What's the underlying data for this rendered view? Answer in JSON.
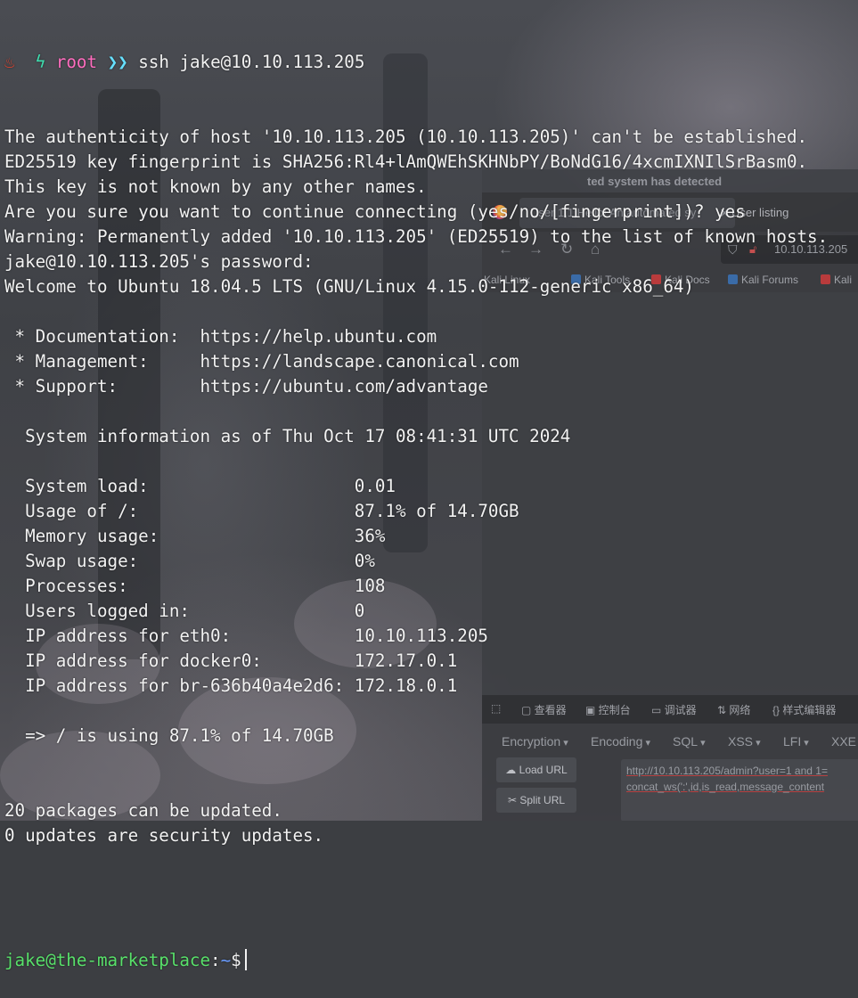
{
  "terminal": {
    "prompt_user": "root",
    "command": "ssh jake@10.10.113.205",
    "lines": [
      "The authenticity of host '10.10.113.205 (10.10.113.205)' can't be established.",
      "ED25519 key fingerprint is SHA256:Rl4+lAmQWEhSKHNbPY/BoNdG16/4xcmIXNIlSrBasm0.",
      "This key is not known by any other names.",
      "Are you sure you want to continue connecting (yes/no/[fingerprint])? yes",
      "Warning: Permanently added '10.10.113.205' (ED25519) to the list of known hosts.",
      "jake@10.10.113.205's password:",
      "Welcome to Ubuntu 18.04.5 LTS (GNU/Linux 4.15.0-112-generic x86_64)",
      "",
      " * Documentation:  https://help.ubuntu.com",
      " * Management:     https://landscape.canonical.com",
      " * Support:        https://ubuntu.com/advantage",
      "",
      "  System information as of Thu Oct 17 08:41:31 UTC 2024",
      "",
      "  System load:                    0.01",
      "  Usage of /:                     87.1% of 14.70GB",
      "  Memory usage:                   36%",
      "  Swap usage:                     0%",
      "  Processes:                      108",
      "  Users logged in:                0",
      "  IP address for eth0:            10.10.113.205",
      "  IP address for docker0:         172.17.0.1",
      "  IP address for br-636b40a4e2d6: 172.18.0.1",
      "",
      "  => / is using 87.1% of 14.70GB",
      "",
      "",
      "20 packages can be updated.",
      "0 updates are security updates.",
      "",
      ""
    ],
    "final_prompt": {
      "user_host": "jake@the-marketplace",
      "sep": ":",
      "path": "~",
      "symbol": "$"
    }
  },
  "browser": {
    "notification": "has detected",
    "notification_prefix": "ted system",
    "tabs": [
      {
        "label": "User 1,1,Hello! An automated sy"
      },
      {
        "label": "User listing"
      }
    ],
    "url": "10.10.113.205",
    "bookmarks": [
      "Kali Linux",
      "Kali Tools",
      "Kali Docs",
      "Kali Forums",
      "Kali"
    ],
    "devtools_tabs": [
      "查看器",
      "控制台",
      "调试器",
      "网络",
      "样式编辑器"
    ],
    "hackbar_menu": [
      "Encryption",
      "Encoding",
      "SQL",
      "XSS",
      "LFI",
      "XXE"
    ],
    "hackbar_buttons": [
      "Load URL",
      "Split URL"
    ],
    "hackbar_text": [
      "http://10.10.113.205/admin?user=1 and 1=",
      "concat_ws(':',id,is_read,message_content"
    ]
  }
}
